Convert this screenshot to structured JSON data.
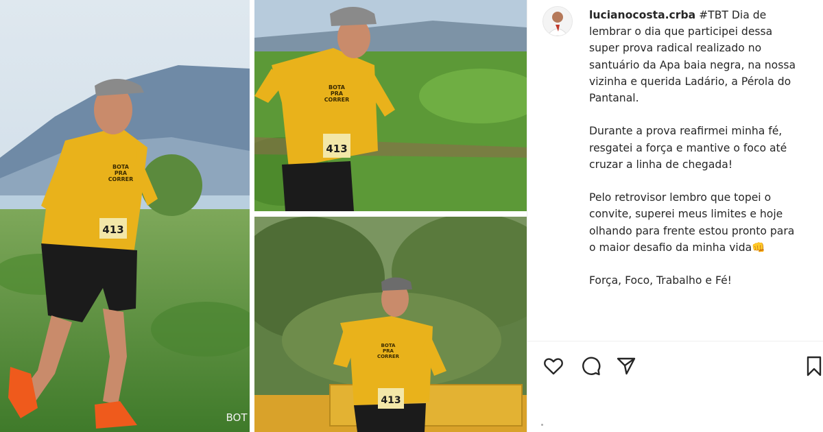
{
  "post": {
    "username": "lucianocosta.crba",
    "caption": " #TBT Dia de\nlembrar o dia que participei dessa\nsuper prova radical realizado no\nsantuário da Apa baia negra, na nossa\nvizinha e querida Ladário, a Pérola do\nPantanal.\n\nDurante a prova reafirmei minha fé,\nresgatei a força e mantive o foco até\ncruzar a linha de chegada!\n\nPelo retrovisor lembro que topei o\nconvite, superei meus limites e hoje\nolhando para frente estou pronto para\no maior desafio da minha vida👊\n\nForça, Foco, Trabalho e Fé!"
  },
  "photos": {
    "bib_number": "413",
    "shirt_text": [
      "BOTA",
      "PRA",
      "CORRER"
    ],
    "watermark": "BOT"
  },
  "icons": {
    "like": "heart-icon",
    "comment": "comment-icon",
    "share": "paper-plane-icon",
    "save": "bookmark-icon"
  },
  "colors": {
    "shirt_yellow": "#e9b21b",
    "grass_green": "#5f9a3a",
    "sky_blue": "#a9c4db",
    "shoe_orange": "#ef5a1c"
  }
}
